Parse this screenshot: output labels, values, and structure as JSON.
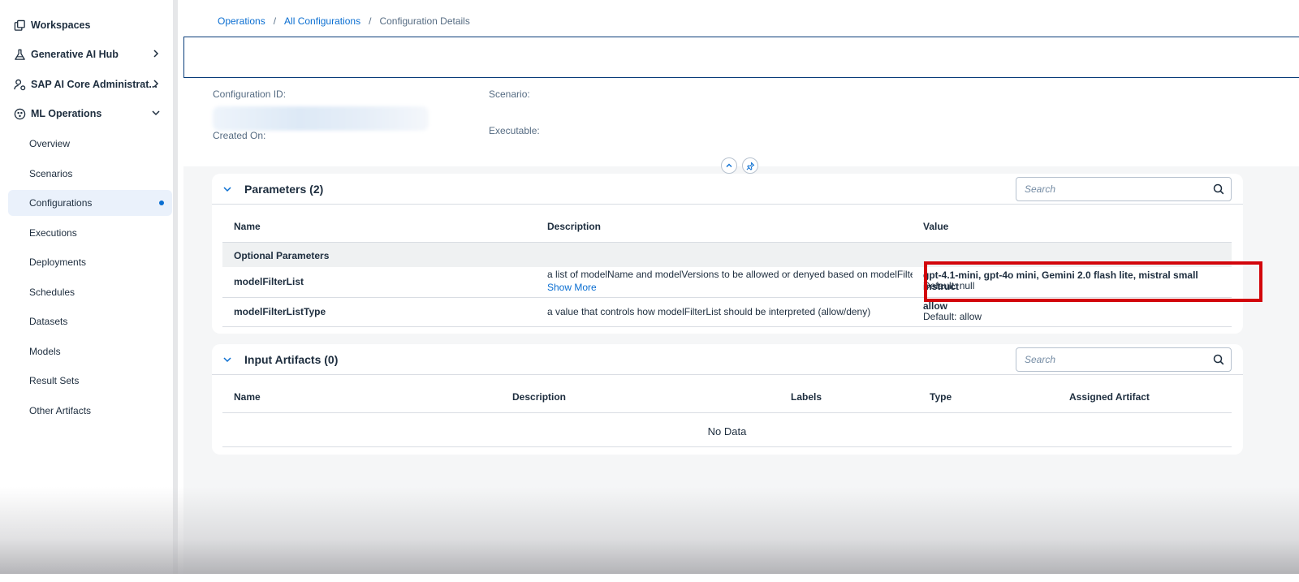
{
  "sidebar": {
    "top_items": [
      {
        "label": "Workspaces"
      },
      {
        "label": "Generative AI Hub"
      },
      {
        "label": "SAP AI Core Administrat..."
      },
      {
        "label": "ML Operations"
      }
    ],
    "sub_items": [
      {
        "label": "Overview"
      },
      {
        "label": "Scenarios"
      },
      {
        "label": "Configurations"
      },
      {
        "label": "Executions"
      },
      {
        "label": "Deployments"
      },
      {
        "label": "Schedules"
      },
      {
        "label": "Datasets"
      },
      {
        "label": "Models"
      },
      {
        "label": "Result Sets"
      },
      {
        "label": "Other Artifacts"
      }
    ],
    "selected": "Configurations"
  },
  "breadcrumb": {
    "items": [
      "Operations",
      "All Configurations"
    ],
    "separator": "/",
    "current": "Configuration Details"
  },
  "header": {
    "config_id_label": "Configuration ID:",
    "created_on_label": "Created On:",
    "scenario_label": "Scenario:",
    "executable_label": "Executable:"
  },
  "parameters": {
    "title": "Parameters (2)",
    "search_placeholder": "Search",
    "columns": [
      "Name",
      "Description",
      "Value"
    ],
    "group": "Optional Parameters",
    "rows": [
      {
        "name": "modelFilterList",
        "description": "a list of modelName and modelVersions to be allowed or denyed based on modelFilte...",
        "show_more": "Show More",
        "value": "gpt-4.1-mini, gpt-4o mini, Gemini 2.0 flash lite, mistral small instruct",
        "default": "Default: null"
      },
      {
        "name": "modelFilterListType",
        "description": "a value that controls how modelFilterList should be interpreted (allow/deny)",
        "value": "allow",
        "default": "Default: allow"
      }
    ]
  },
  "input_artifacts": {
    "title": "Input Artifacts (0)",
    "search_placeholder": "Search",
    "columns": [
      "Name",
      "Description",
      "Labels",
      "Type",
      "Assigned Artifact"
    ],
    "empty_text": "No Data"
  },
  "colors": {
    "accent": "#0a6ed1",
    "highlight_box": "#d2050b",
    "selected_bg": "#eaf1fb"
  }
}
